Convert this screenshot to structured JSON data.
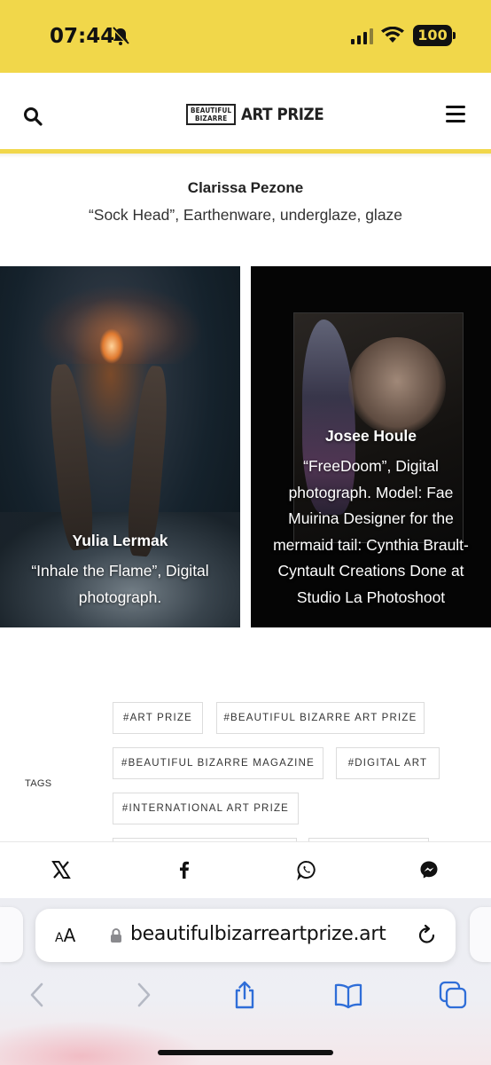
{
  "status_bar": {
    "time": "07:44",
    "battery": "100"
  },
  "header": {
    "logo_small_line1": "BEAUTIFUL",
    "logo_small_line2": "BIZARRE",
    "logo_main": "ART PRIZE"
  },
  "caption": {
    "artist": "Clarissa Pezone",
    "description": "“Sock Head”, Earthenware, underglaze, glaze"
  },
  "artworks": [
    {
      "artist": "Yulia Lermak",
      "description": "“Inhale the Flame”, Digital photograph."
    },
    {
      "artist": "Josee Houle",
      "description": "“FreeDoom”, Digital photograph. Model: Fae Muirina Designer for the mermaid tail: Cynthia Brault-Cyntault Creations Done at Studio La Photoshoot"
    }
  ],
  "tags": {
    "label": "TAGS",
    "items": [
      "#ART PRIZE",
      "#BEAUTIFUL BIZARRE ART PRIZE",
      "#BEAUTIFUL BIZARRE MAGAZINE",
      "#DIGITAL ART",
      "#INTERNATIONAL ART PRIZE",
      "",
      ""
    ]
  },
  "share": {
    "icons": [
      "x-icon",
      "facebook-icon",
      "whatsapp-icon",
      "messenger-icon"
    ]
  },
  "browser": {
    "aa_label_small": "A",
    "aa_label_large": "A",
    "url": "beautifulbizarreartprize.art"
  },
  "colors": {
    "brand_yellow": "#f1d74a",
    "text_dark": "#1a1a1a"
  }
}
